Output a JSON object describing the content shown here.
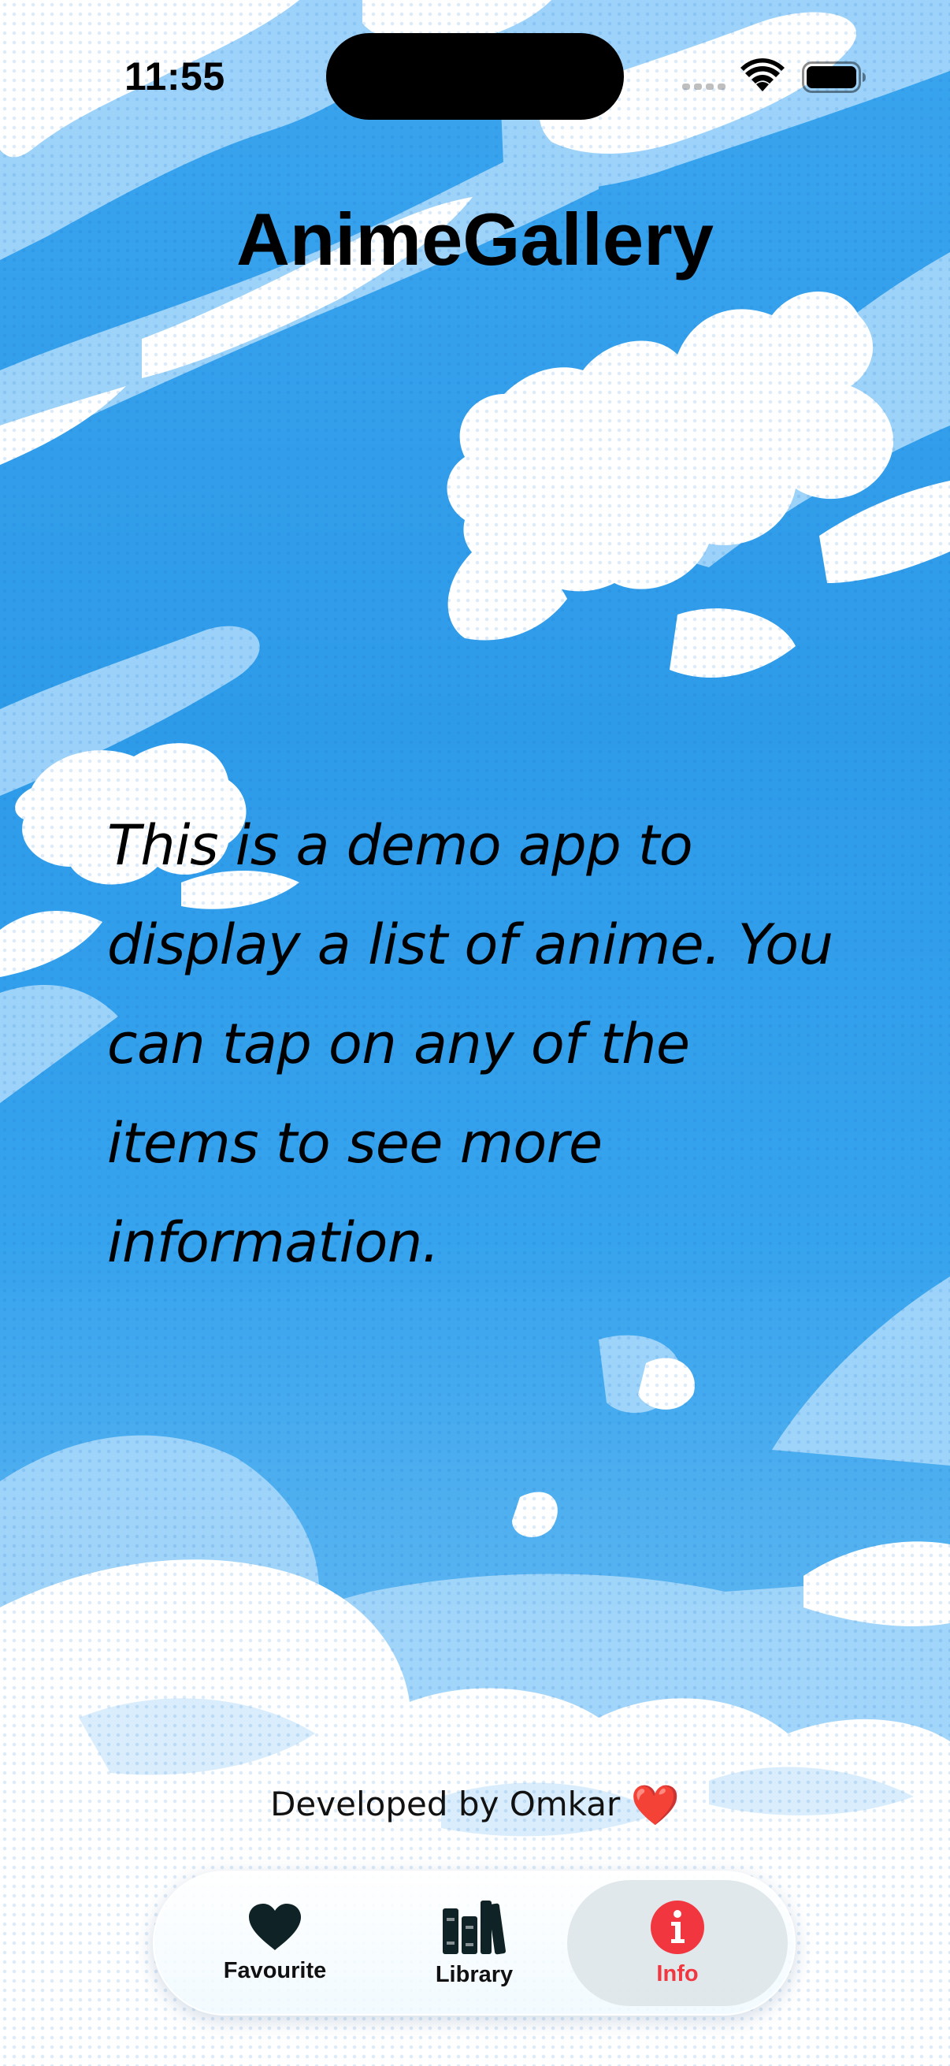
{
  "status_bar": {
    "time": "11:55"
  },
  "header": {
    "title": "AnimeGallery"
  },
  "main": {
    "description": "This is a demo app to display a list of anime. You can tap on any of the items to see more information."
  },
  "footer": {
    "credit_text": "Developed by Omkar",
    "credit_emoji": "❤️"
  },
  "tabbar": {
    "tabs": [
      {
        "label": "Favourite",
        "icon": "heart-icon",
        "active": false
      },
      {
        "label": "Library",
        "icon": "books-icon",
        "active": false
      },
      {
        "label": "Info",
        "icon": "info-circle-icon",
        "active": true
      }
    ]
  },
  "colors": {
    "sky_blue": "#2e9be9",
    "active_tab_accent": "#f2363f",
    "inactive_icon": "#0f2326"
  }
}
